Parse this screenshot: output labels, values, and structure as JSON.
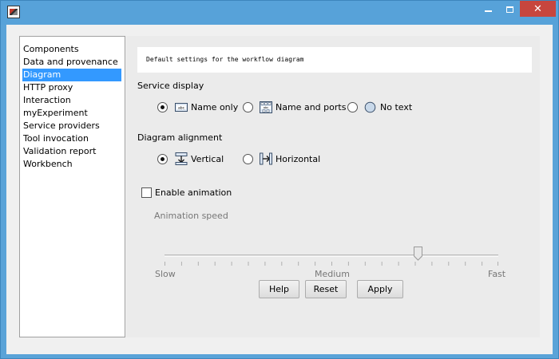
{
  "window": {
    "title": "",
    "controls": {
      "minimize": "",
      "maximize": "",
      "close": "✕"
    }
  },
  "sidebar": {
    "items": [
      {
        "label": "Components",
        "selected": false
      },
      {
        "label": "Data and provenance",
        "selected": false
      },
      {
        "label": "Diagram",
        "selected": true
      },
      {
        "label": "HTTP proxy",
        "selected": false
      },
      {
        "label": "Interaction",
        "selected": false
      },
      {
        "label": "myExperiment",
        "selected": false
      },
      {
        "label": "Service providers",
        "selected": false
      },
      {
        "label": "Tool invocation",
        "selected": false
      },
      {
        "label": "Validation report",
        "selected": false
      },
      {
        "label": "Workbench",
        "selected": false
      }
    ]
  },
  "content": {
    "description": "Default settings for the workflow diagram",
    "service_display": {
      "label": "Service display",
      "options": [
        {
          "label": "Name only",
          "icon": "name-only-icon",
          "checked": true
        },
        {
          "label": "Name and ports",
          "icon": "name-and-ports-icon",
          "checked": false
        },
        {
          "label": "No text",
          "icon": "no-text-icon",
          "checked": false
        }
      ]
    },
    "diagram_alignment": {
      "label": "Diagram alignment",
      "options": [
        {
          "label": "Vertical",
          "icon": "vertical-icon",
          "checked": true
        },
        {
          "label": "Horizontal",
          "icon": "horizontal-icon",
          "checked": false
        }
      ]
    },
    "animation": {
      "checkbox_label": "Enable animation",
      "enabled": false,
      "speed_label": "Animation speed",
      "speed_ticks": {
        "slow": "Slow",
        "medium": "Medium",
        "fast": "Fast"
      },
      "speed_fraction": 0.76
    },
    "buttons": {
      "help": "Help",
      "reset": "Reset",
      "apply": "Apply"
    }
  },
  "colors": {
    "titlebar": "#57a2d9",
    "selection": "#3399ff",
    "close_button": "#c7463e"
  }
}
